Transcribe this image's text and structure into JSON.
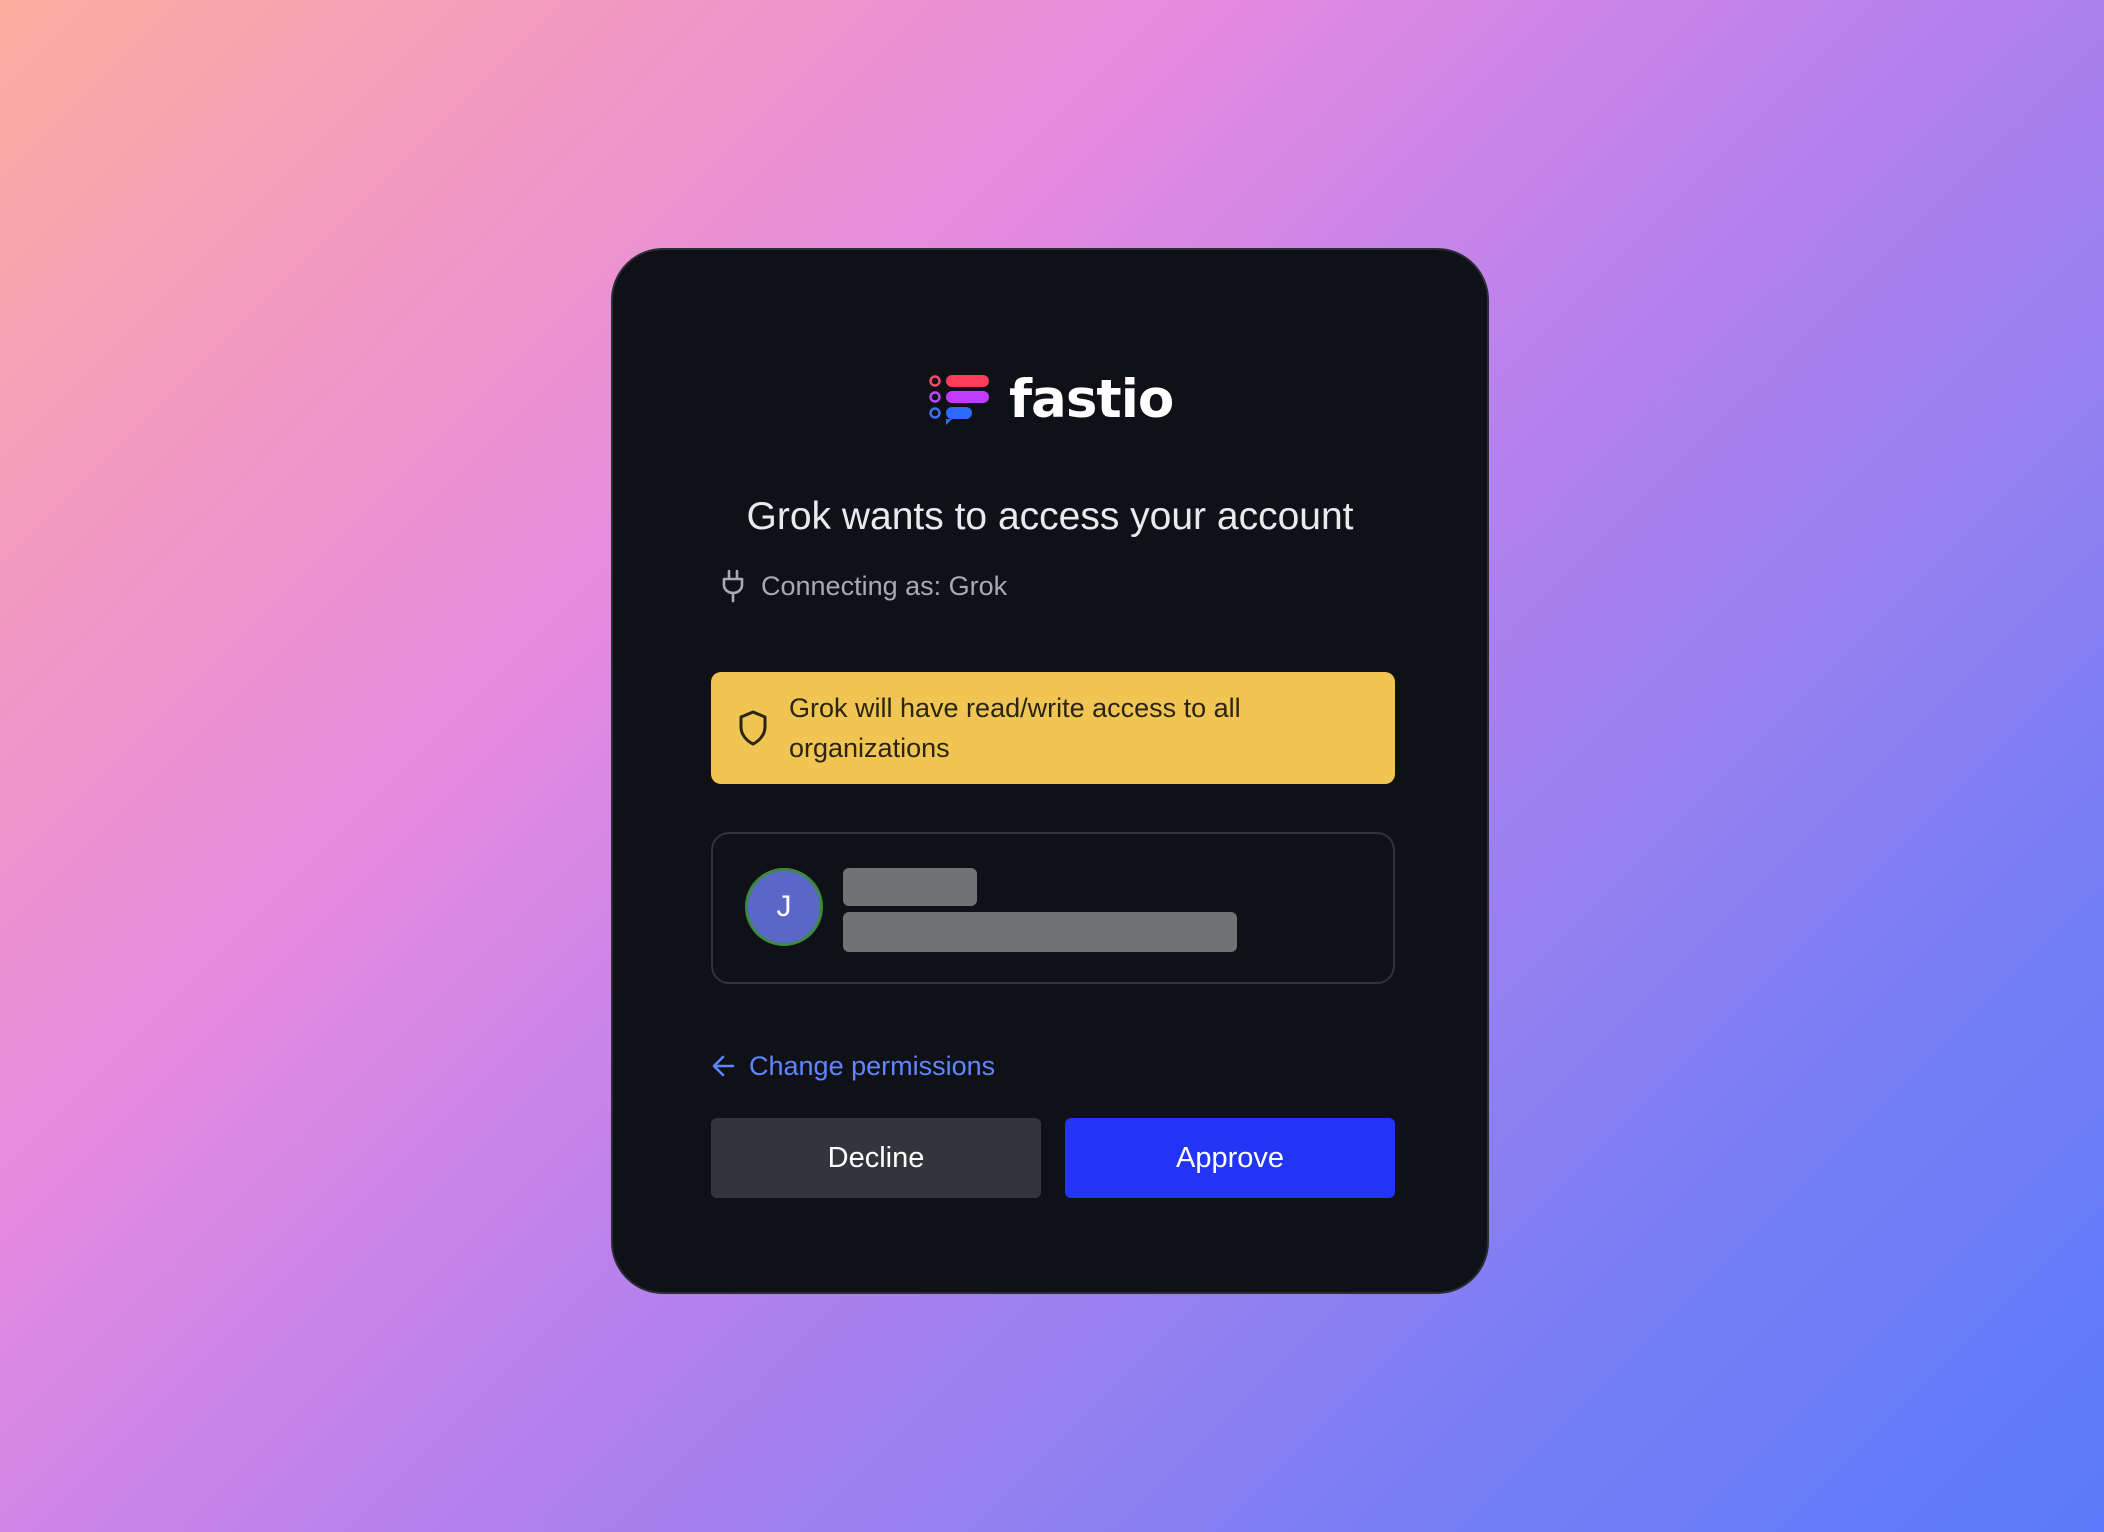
{
  "brand": {
    "name": "fastio",
    "colors": [
      "#ff3b5c",
      "#c13bff",
      "#2d6bff"
    ]
  },
  "dialog": {
    "title": "Grok wants to access your account",
    "connecting_as": "Connecting as: Grok",
    "connecting_icon": "plug-icon"
  },
  "warning": {
    "icon": "shield-icon",
    "text": "Grok will have read/write access to all organizations",
    "background": "#f0c554"
  },
  "account": {
    "avatar_initial": "J",
    "avatar_color": "#5b67c6"
  },
  "actions": {
    "change_permissions": "Change permissions",
    "decline": "Decline",
    "approve": "Approve",
    "approve_color": "#2235f5"
  }
}
